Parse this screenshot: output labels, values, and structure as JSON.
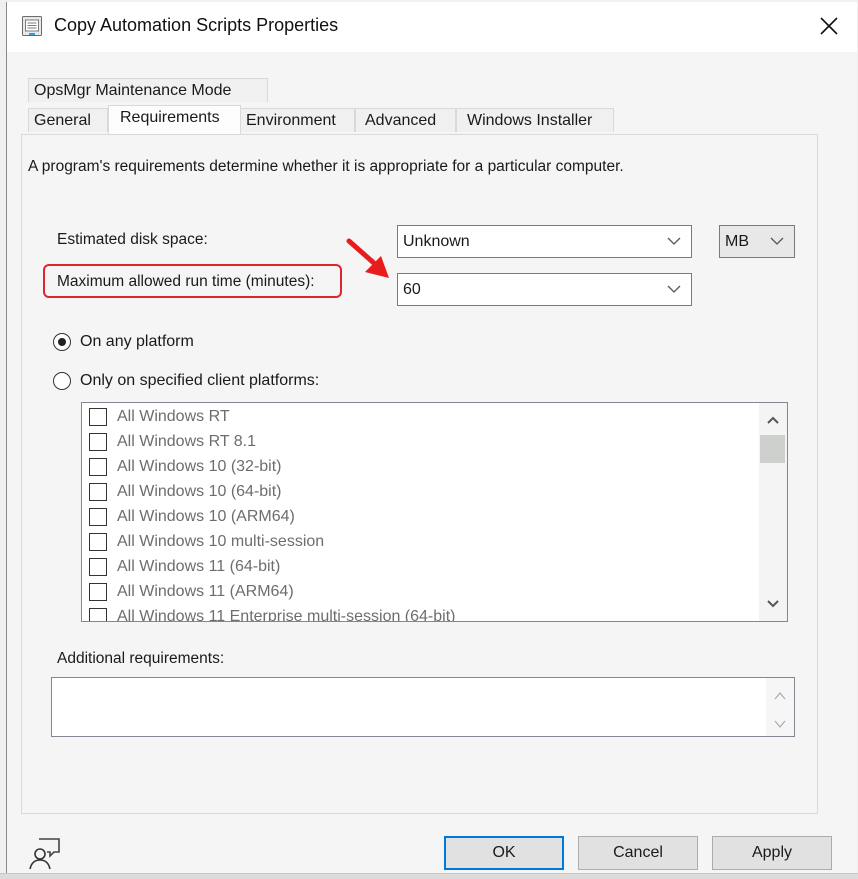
{
  "window": {
    "title": "Copy Automation Scripts Properties",
    "icon": "properties-sheet-icon",
    "close_icon": "close-icon"
  },
  "tabs": {
    "row_back": [
      {
        "label": "OpsMgr Maintenance Mode"
      }
    ],
    "row_front": [
      {
        "label": "General",
        "active": false
      },
      {
        "label": "Requirements",
        "active": true
      },
      {
        "label": "Environment",
        "active": false
      },
      {
        "label": "Advanced",
        "active": false
      },
      {
        "label": "Windows Installer",
        "active": false
      }
    ]
  },
  "requirements": {
    "intro": "A program's requirements determine whether it is appropriate for a particular computer.",
    "disk_space": {
      "label": "Estimated disk space:",
      "value": "Unknown",
      "unit": "MB"
    },
    "max_run_time": {
      "label": "Maximum allowed run time (minutes):",
      "value": "60",
      "highlighted": true,
      "annotation_color": "#e0232e"
    },
    "platform": {
      "options": [
        {
          "label": "On any platform",
          "checked": true
        },
        {
          "label": "Only on specified client platforms:",
          "checked": false
        }
      ],
      "list": [
        {
          "label": "All Windows RT",
          "checked": false
        },
        {
          "label": "All Windows RT 8.1",
          "checked": false
        },
        {
          "label": "All Windows 10 (32-bit)",
          "checked": false
        },
        {
          "label": "All Windows 10 (64-bit)",
          "checked": false
        },
        {
          "label": "All Windows 10 (ARM64)",
          "checked": false
        },
        {
          "label": "All Windows 10 multi-session",
          "checked": false
        },
        {
          "label": "All Windows 11 (64-bit)",
          "checked": false
        },
        {
          "label": "All Windows 11 (ARM64)",
          "checked": false
        },
        {
          "label": "All Windows 11 Enterprise multi-session (64-bit)",
          "checked": false
        }
      ]
    },
    "additional": {
      "label": "Additional requirements:",
      "value": ""
    }
  },
  "footer": {
    "help_icon": "user-feedback-icon",
    "ok_label": "OK",
    "cancel_label": "Cancel",
    "apply_label": "Apply"
  },
  "colors": {
    "accent": "#0078d7",
    "annotation": "#e0232e"
  }
}
